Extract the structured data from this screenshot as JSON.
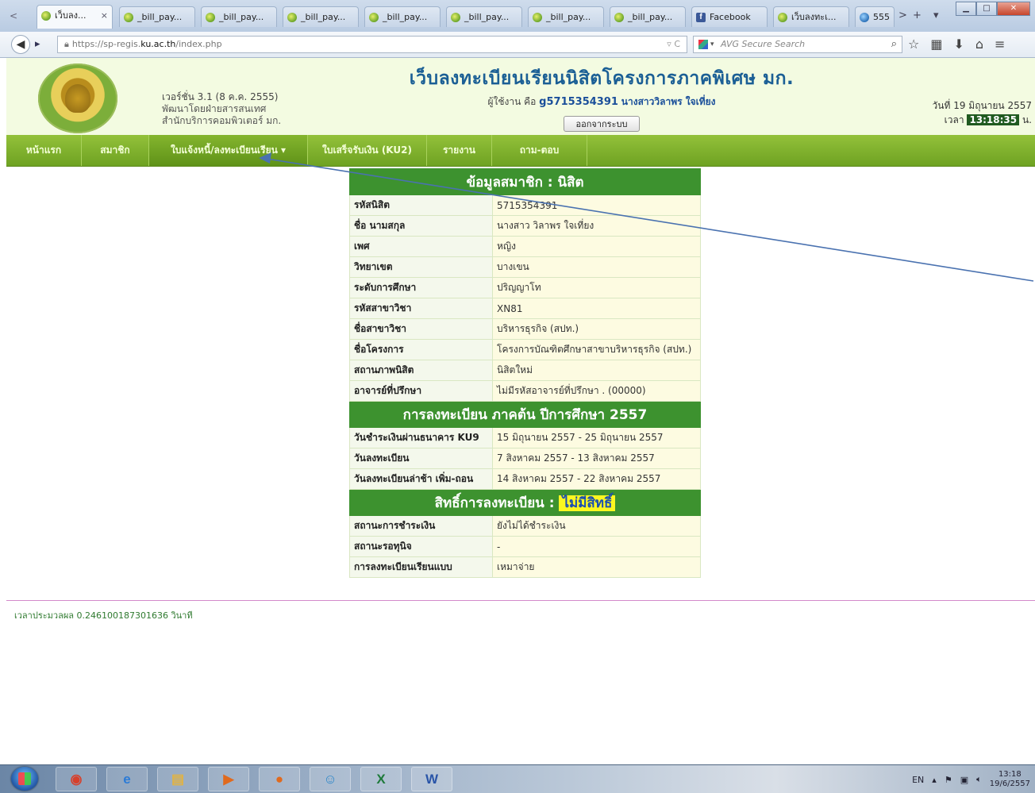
{
  "browser": {
    "tabs": [
      {
        "label": "เว็บลง...",
        "active": true,
        "favicon": "ku-seal-icon"
      },
      {
        "label": "_bill_pay...",
        "favicon": "ku-seal-icon"
      },
      {
        "label": "_bill_pay...",
        "favicon": "ku-seal-icon"
      },
      {
        "label": "_bill_pay...",
        "favicon": "ku-seal-icon"
      },
      {
        "label": "_bill_pay...",
        "favicon": "ku-seal-icon"
      },
      {
        "label": "_bill_pay...",
        "favicon": "ku-seal-icon"
      },
      {
        "label": "_bill_pay...",
        "favicon": "ku-seal-icon"
      },
      {
        "label": "_bill_pay...",
        "favicon": "ku-seal-icon"
      },
      {
        "label": "Facebook",
        "favicon": "facebook-icon"
      },
      {
        "label": "เว็บลงทะเ...",
        "favicon": "ku-seal-icon"
      },
      {
        "label": "555",
        "favicon": "globe-icon"
      }
    ],
    "tab_close": "×",
    "tab_more": ">",
    "tab_new": "+",
    "tab_list": "▾",
    "url_prefix": "https://sp-regis.",
    "url_host": "ku.ac.th",
    "url_path": "/index.php",
    "url_icons": "▿ C",
    "search_placeholder": "AVG Secure Search",
    "search_caret": "▾"
  },
  "header": {
    "version": "เวอร์ชั่น 3.1 (8 ค.ค. 2555)",
    "dev_by": "พัฒนาโดยฝ่ายสารสนเทศ",
    "office": "สำนักบริการคอมพิวเตอร์ มก.",
    "title": "เว็บลงทะเบียนเรียนนิสิตโครงการภาคพิเศษ มก.",
    "user_prefix": "ผู้ใช้งาน คือ",
    "user_id": "g5715354391",
    "user_name": "นางสาววิลาพร ใจเที่ยง",
    "logout": "ออกจากระบบ",
    "date": "วันที่ 19 มิถุนายน 2557",
    "time_prefix": "เวลา",
    "time": "13:18:35",
    "time_suffix": "น."
  },
  "menu": [
    {
      "label": "หน้าแรก"
    },
    {
      "label": "สมาชิก"
    },
    {
      "label": "ใบแจ้งหนี้/ลงทะเบียนเรียน ▾"
    },
    {
      "label": "ใบเสร็จรับเงิน (KU2)"
    },
    {
      "label": "รายงาน"
    },
    {
      "label": "ถาม-ตอบ"
    }
  ],
  "member": {
    "heading": "ข้อมูลสมาชิก : นิสิต",
    "rows": [
      {
        "k": "รหัสนิสิต",
        "v": "5715354391"
      },
      {
        "k": "ชื่อ นามสกุล",
        "v": "นางสาว วิลาพร ใจเที่ยง"
      },
      {
        "k": "เพศ",
        "v": "หญิง"
      },
      {
        "k": "วิทยาเขต",
        "v": "บางเขน"
      },
      {
        "k": "ระดับการศึกษา",
        "v": "ปริญญาโท"
      },
      {
        "k": "รหัสสาขาวิชา",
        "v": "XN81"
      },
      {
        "k": "ชื่อสาขาวิชา",
        "v": "บริหารธุรกิจ (สปท.)"
      },
      {
        "k": "ชื่อโครงการ",
        "v": "โครงการบัณฑิตศึกษาสาขาบริหารธุรกิจ (สปท.)"
      },
      {
        "k": "สถานภาพนิสิต",
        "v": "นิสิตใหม่"
      },
      {
        "k": "อาจารย์ที่ปรึกษา",
        "v": "ไม่มีรหัสอาจารย์ที่ปรึกษา . (00000)"
      }
    ]
  },
  "registration": {
    "heading": "การลงทะเบียน ภาคต้น ปีการศึกษา 2557",
    "rows": [
      {
        "k": "วันชำระเงินผ่านธนาคาร KU9",
        "v": "15 มิถุนายน 2557 - 25 มิถุนายน 2557"
      },
      {
        "k": "วันลงทะเบียน",
        "v": "7 สิงหาคม 2557 - 13 สิงหาคม 2557"
      },
      {
        "k": "วันลงทะเบียนล่าช้า เพิ่ม-ถอน",
        "v": "14 สิงหาคม 2557 - 22 สิงหาคม 2557"
      }
    ]
  },
  "rights": {
    "heading": "สิทธิ์การลงทะเบียน :",
    "status": "ไม่มีสิทธิ์",
    "rows": [
      {
        "k": "สถานะการชำระเงิน",
        "v": "ยังไม่ได้ชำระเงิน"
      },
      {
        "k": "สถานะรอทุนิจ",
        "v": "-"
      },
      {
        "k": "การลงทะเบียนเรียนแบบ",
        "v": "เหมาจ่าย"
      }
    ]
  },
  "footer": {
    "processing_time": "เวลาประมวลผล 0.246100187301636 วินาที"
  },
  "taskbar": {
    "apps": [
      {
        "name": "chrome-icon",
        "glyph": "◉",
        "color": "#d6402c"
      },
      {
        "name": "ie-icon",
        "glyph": "e",
        "color": "#2b7bd6"
      },
      {
        "name": "file-explorer-icon",
        "glyph": "▤",
        "color": "#e3b340"
      },
      {
        "name": "media-player-icon",
        "glyph": "▶",
        "color": "#e06a1e"
      },
      {
        "name": "firefox-icon",
        "glyph": "●",
        "color": "#e06a1e"
      },
      {
        "name": "messenger-icon",
        "glyph": "☺",
        "color": "#2a86c9"
      },
      {
        "name": "excel-icon",
        "glyph": "X",
        "color": "#1e7a3b"
      },
      {
        "name": "word-icon",
        "glyph": "W",
        "color": "#2a55a8"
      }
    ],
    "lang": "EN",
    "time": "13:18",
    "date": "19/6/2557"
  },
  "colors": {
    "menu_green": "#6ea222",
    "section_green": "#3d922f",
    "title_blue": "#1b5f95",
    "highlight_yellow": "#fbf720"
  }
}
